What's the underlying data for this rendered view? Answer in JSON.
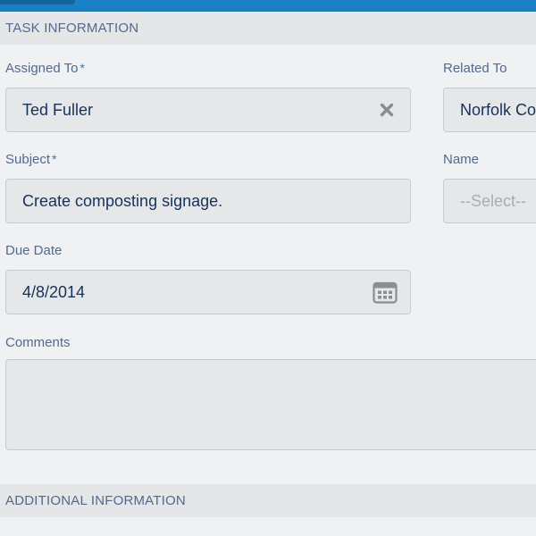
{
  "sections": {
    "task_information": "TASK INFORMATION",
    "additional_information": "ADDITIONAL INFORMATION"
  },
  "fields": {
    "assigned_to": {
      "label": "Assigned To",
      "required_mark": "*",
      "value": "Ted Fuller"
    },
    "related_to": {
      "label": "Related To",
      "value": "Norfolk Co"
    },
    "subject": {
      "label": "Subject",
      "required_mark": "*",
      "value": "Create composting signage."
    },
    "name": {
      "label": "Name",
      "placeholder": "--Select--"
    },
    "due_date": {
      "label": "Due Date",
      "value": "4/8/2014"
    },
    "comments": {
      "label": "Comments",
      "value": ""
    }
  },
  "icons": {
    "clear": "close-icon",
    "calendar": "calendar-icon"
  },
  "colors": {
    "accent": "#1a7fc4",
    "label": "#54698d",
    "text": "#16325c",
    "input_bg": "#e6e7e8",
    "section_bg": "#e4e6e8",
    "page_bg": "#f0f1f2"
  }
}
